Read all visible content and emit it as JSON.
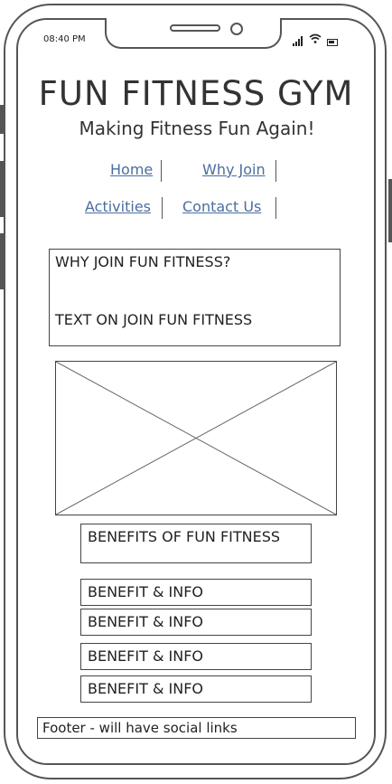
{
  "status_bar": {
    "time": "08:40 PM",
    "wifi_icon": "wifi-icon",
    "signal_icon": "signal-icon",
    "battery_icon": "battery-icon"
  },
  "header": {
    "title": "FUN FITNESS GYM",
    "tagline": "Making Fitness Fun Again!"
  },
  "nav": {
    "items": [
      {
        "label": "Home"
      },
      {
        "label": "Why Join"
      },
      {
        "label": "Activities"
      },
      {
        "label": "Contact Us"
      }
    ]
  },
  "why_join": {
    "heading": "WHY JOIN FUN FITNESS?",
    "body": "TEXT ON JOIN FUN FITNESS"
  },
  "image_placeholder": {
    "icon": "image-placeholder-icon"
  },
  "benefits": {
    "heading": "BENEFITS OF FUN FITNESS",
    "items": [
      {
        "label": "BENEFIT & INFO"
      },
      {
        "label": "BENEFIT & INFO"
      },
      {
        "label": "BENEFIT & INFO"
      },
      {
        "label": "BENEFIT & INFO"
      }
    ]
  },
  "footer": {
    "text": "Footer - will have social links"
  }
}
